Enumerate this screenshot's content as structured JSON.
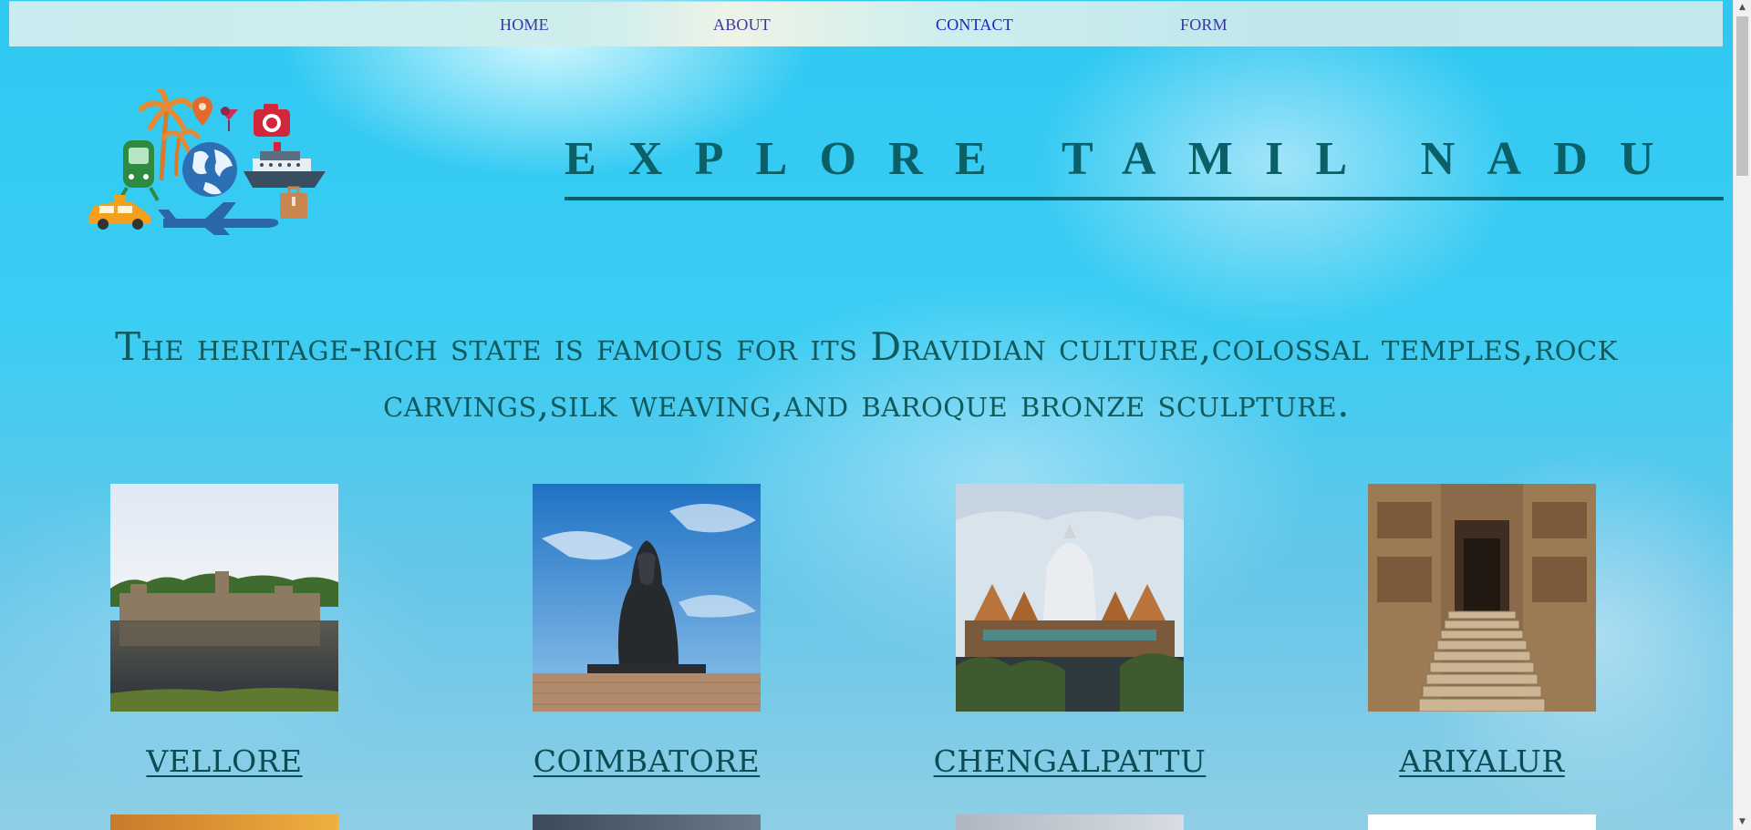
{
  "nav": {
    "home": "HOME",
    "about": "ABOUT",
    "contact": "CONTACT",
    "form": "FORM"
  },
  "header": {
    "title": "EXPLORE TAMIL NADU",
    "logo_icon": "travel-collage-logo"
  },
  "intro": {
    "text": "The heritage-rich state is famous for its Dravidian culture,colossal temples,rock carvings,silk weaving,and baroque bronze sculpture."
  },
  "places": [
    {
      "name": "VELLORE",
      "image": "fort-reflection-photo"
    },
    {
      "name": "COIMBATORE",
      "image": "adiyogi-statue-photo"
    },
    {
      "name": "CHENGALPATTU",
      "image": "temple-photo"
    },
    {
      "name": "ARIYALUR",
      "image": "temple-stairway-photo"
    }
  ],
  "colors": {
    "title": "#0b5f66",
    "nav_link": "#3a35a6",
    "nav_link_visited": "#1e22c6",
    "caption": "#0b4b53"
  }
}
